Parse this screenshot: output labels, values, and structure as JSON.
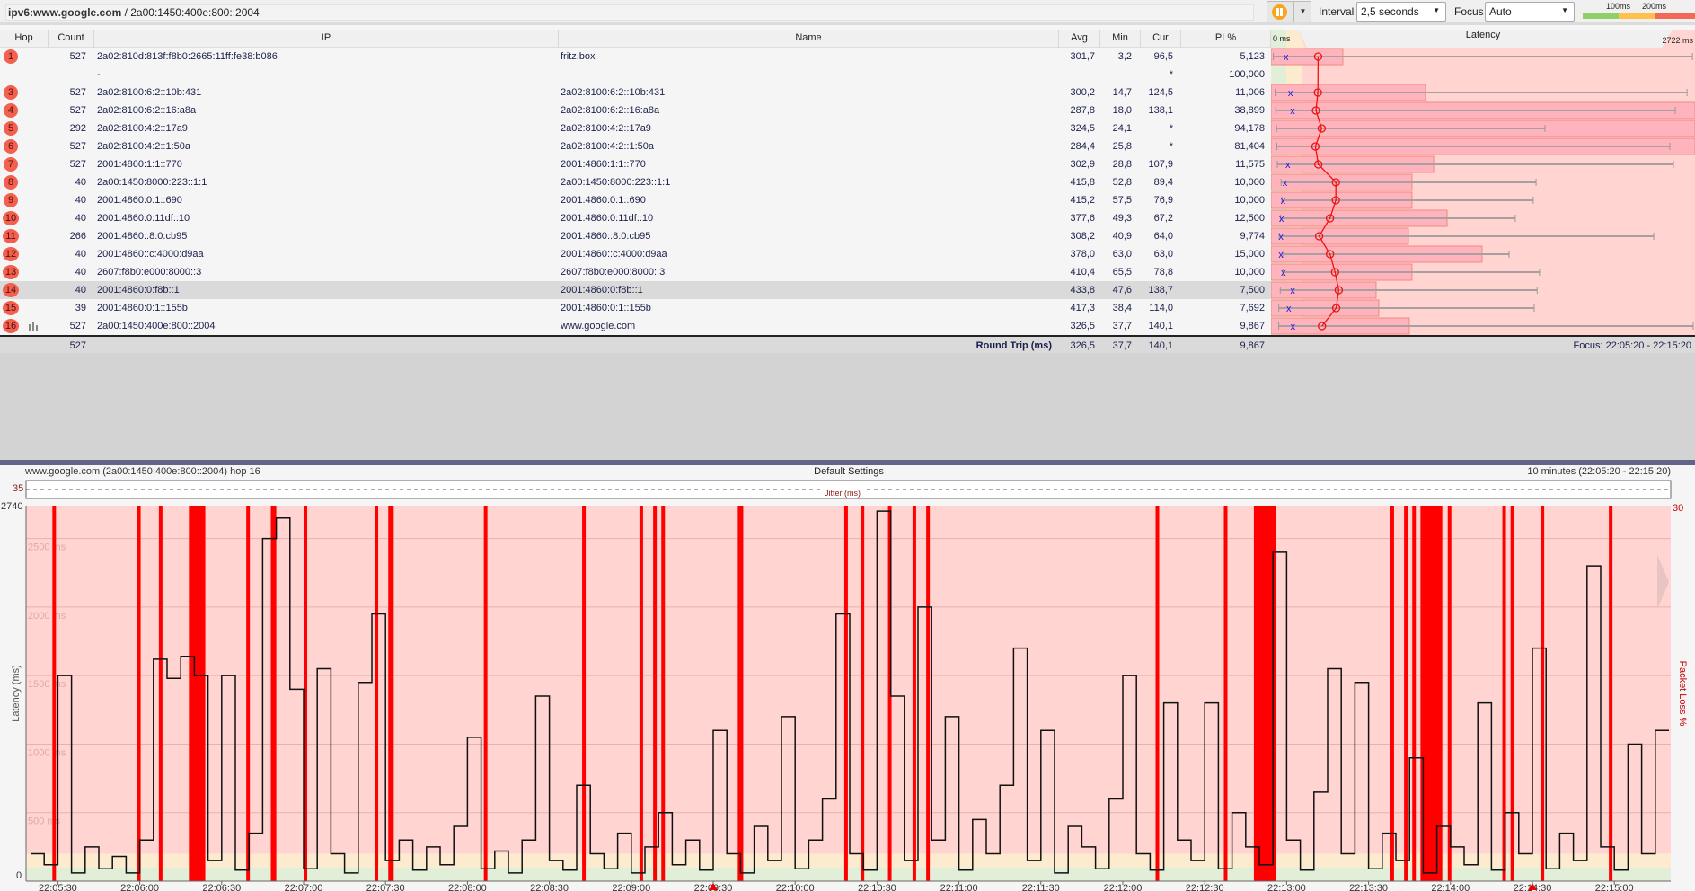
{
  "window": {
    "title_host": "ipv6:www.google.com",
    "title_ip": "/ 2a00:1450:400e:800::2004"
  },
  "toolbar": {
    "pause_icon": "pause-icon",
    "interval_label": "Interval",
    "interval_value": "2,5 seconds",
    "focus_label": "Focus",
    "focus_value": "Auto",
    "legend": {
      "t100": "100ms",
      "t200": "200ms",
      "colors": [
        "#8ed06a",
        "#ffc04c",
        "#f26a55"
      ]
    }
  },
  "table": {
    "headers": {
      "hop": "Hop",
      "count": "Count",
      "ip": "IP",
      "name": "Name",
      "avg": "Avg",
      "min": "Min",
      "cur": "Cur",
      "pl": "PL%",
      "latency": "Latency",
      "lat_min": "0 ms",
      "lat_max": "2722 ms"
    },
    "latency_scale_max_ms": 2722,
    "rows": [
      {
        "hop": "1",
        "count": "527",
        "ip": "2a02:810d:813f:f8b0:2665:11ff:fe38:b086",
        "name": "fritz.box",
        "avg": "301,7",
        "min": "3,2",
        "cur": "96,5",
        "pl": "5,123",
        "bar_ms": 460,
        "max_ms": 2700
      },
      {
        "hop": "",
        "count": "",
        "ip": "-",
        "name": "",
        "avg": "",
        "min": "",
        "cur": "*",
        "pl": "100,000"
      },
      {
        "hop": "3",
        "count": "527",
        "ip": "2a02:8100:6:2::10b:431",
        "name": "2a02:8100:6:2::10b:431",
        "avg": "300,2",
        "min": "14,7",
        "cur": "124,5",
        "pl": "11,006",
        "bar_ms": 990,
        "max_ms": 2665
      },
      {
        "hop": "4",
        "count": "527",
        "ip": "2a02:8100:6:2::16:a8a",
        "name": "2a02:8100:6:2::16:a8a",
        "avg": "287,8",
        "min": "18,0",
        "cur": "138,1",
        "pl": "38,899",
        "bar_ms": 2722,
        "max_ms": 2590
      },
      {
        "hop": "5",
        "count": "292",
        "ip": "2a02:8100:4:2::17a9",
        "name": "2a02:8100:4:2::17a9",
        "avg": "324,5",
        "min": "24,1",
        "cur": "*",
        "pl": "94,178",
        "bar_ms": 2722,
        "max_ms": 1755
      },
      {
        "hop": "6",
        "count": "527",
        "ip": "2a02:8100:4:2::1:50a",
        "name": "2a02:8100:4:2::1:50a",
        "avg": "284,4",
        "min": "25,8",
        "cur": "*",
        "pl": "81,404",
        "bar_ms": 2722,
        "max_ms": 2555
      },
      {
        "hop": "7",
        "count": "527",
        "ip": "2001:4860:1:1::770",
        "name": "2001:4860:1:1::770",
        "avg": "302,9",
        "min": "28,8",
        "cur": "107,9",
        "pl": "11,575",
        "bar_ms": 1042,
        "max_ms": 2578
      },
      {
        "hop": "8",
        "count": "40",
        "ip": "2a00:1450:8000:223::1:1",
        "name": "2a00:1450:8000:223::1:1",
        "avg": "415,8",
        "min": "52,8",
        "cur": "89,4",
        "pl": "10,000",
        "bar_ms": 903,
        "max_ms": 1698
      },
      {
        "hop": "9",
        "count": "40",
        "ip": "2001:4860:0:1::690",
        "name": "2001:4860:0:1::690",
        "avg": "415,2",
        "min": "57,5",
        "cur": "76,9",
        "pl": "10,000",
        "bar_ms": 903,
        "max_ms": 1680
      },
      {
        "hop": "10",
        "count": "40",
        "ip": "2001:4860:0:11df::10",
        "name": "2001:4860:0:11df::10",
        "avg": "377,6",
        "min": "49,3",
        "cur": "67,2",
        "pl": "12,500",
        "bar_ms": 1128,
        "max_ms": 1565
      },
      {
        "hop": "11",
        "count": "266",
        "ip": "2001:4860::8:0:cb95",
        "name": "2001:4860::8:0:cb95",
        "avg": "308,2",
        "min": "40,9",
        "cur": "64,0",
        "pl": "9,774",
        "bar_ms": 880,
        "max_ms": 2452
      },
      {
        "hop": "12",
        "count": "40",
        "ip": "2001:4860::c:4000:d9aa",
        "name": "2001:4860::c:4000:d9aa",
        "avg": "378,0",
        "min": "63,0",
        "cur": "63,0",
        "pl": "15,000",
        "bar_ms": 1352,
        "max_ms": 1525
      },
      {
        "hop": "13",
        "count": "40",
        "ip": "2607:f8b0:e000:8000::3",
        "name": "2607:f8b0:e000:8000::3",
        "avg": "410,4",
        "min": "65,5",
        "cur": "78,8",
        "pl": "10,000",
        "bar_ms": 903,
        "max_ms": 1720
      },
      {
        "hop": "14",
        "count": "40",
        "ip": "2001:4860:0:f8b::1",
        "name": "2001:4860:0:f8b::1",
        "avg": "433,8",
        "min": "47,6",
        "cur": "138,7",
        "pl": "7,500",
        "bar_ms": 673,
        "max_ms": 1705,
        "selected": true
      },
      {
        "hop": "15",
        "count": "39",
        "ip": "2001:4860:0:1::155b",
        "name": "2001:4860:0:1::155b",
        "avg": "417,3",
        "min": "38,4",
        "cur": "114,0",
        "pl": "7,692",
        "bar_ms": 690,
        "max_ms": 1686
      },
      {
        "hop": "16",
        "count": "527",
        "ip": "2a00:1450:400e:800::2004",
        "name": "www.google.com",
        "avg": "326,5",
        "min": "37,7",
        "cur": "140,1",
        "pl": "9,867",
        "bar_ms": 886,
        "max_ms": 2722,
        "icon": "bar-chart-icon"
      }
    ],
    "summary": {
      "count": "527",
      "label": "Round Trip (ms)",
      "avg": "326,5",
      "min": "37,7",
      "cur": "140,1",
      "pl": "9,867",
      "focus": "Focus: 22:05:20 - 22:15:20"
    }
  },
  "chart_data": {
    "type": "line",
    "header_left": "www.google.com (2a00:1450:400e:800::2004) hop 16",
    "header_center": "Default Settings",
    "header_right": "10 minutes (22:05:20 - 22:15:20)",
    "jitter": {
      "label": "Jitter (ms)",
      "value_label": "35"
    },
    "ylabel": "Latency (ms)",
    "y2label": "Packet Loss %",
    "ylim": [
      0,
      2740
    ],
    "y_top_label": "2740",
    "y_bottom_label": "0",
    "y2_top_label": "30",
    "y_grid": [
      {
        "v": 500,
        "label": "500 ms"
      },
      {
        "v": 1000,
        "label": "1000 ms"
      },
      {
        "v": 1500,
        "label": "1500 ms"
      },
      {
        "v": 2000,
        "label": "2000 ms"
      },
      {
        "v": 2500,
        "label": "2500 ms"
      }
    ],
    "zones": [
      {
        "to": 100,
        "color": "#e1efd9"
      },
      {
        "to": 200,
        "color": "#fdebcf"
      },
      {
        "to": 2740,
        "color": "#ffd4d1"
      }
    ],
    "x_start": "22:05:20",
    "x_end": "22:15:20",
    "x_ticks": [
      "22:05:30",
      "22:06:00",
      "22:06:30",
      "22:07:00",
      "22:07:30",
      "22:08:00",
      "22:08:30",
      "22:09:00",
      "22:09:30",
      "22:10:00",
      "22:10:30",
      "22:11:00",
      "22:11:30",
      "22:12:00",
      "22:12:30",
      "22:13:00",
      "22:13:30",
      "22:14:00",
      "22:14:30",
      "22:15:00"
    ],
    "sample_step_s": 5,
    "latency_ms": [
      200,
      120,
      1500,
      60,
      250,
      90,
      180,
      60,
      300,
      1620,
      1480,
      1640,
      1500,
      150,
      1500,
      80,
      350,
      2500,
      2650,
      1400,
      90,
      1550,
      200,
      60,
      1450,
      1950,
      150,
      300,
      80,
      250,
      120,
      400,
      1050,
      90,
      220,
      60,
      300,
      1350,
      150,
      80,
      700,
      200,
      90,
      350,
      60,
      250,
      500,
      120,
      300,
      80,
      1100,
      200,
      60,
      400,
      150,
      1200,
      90,
      300,
      600,
      1950,
      200,
      80,
      2700,
      1350,
      150,
      2000,
      300,
      1200,
      80,
      450,
      200,
      700,
      1700,
      150,
      1100,
      60,
      400,
      250,
      90,
      600,
      1500,
      200,
      80,
      1300,
      300,
      150,
      1300,
      90,
      500,
      250,
      120,
      2400,
      300,
      80,
      650,
      1550,
      200,
      1450,
      90,
      350,
      150,
      900,
      60,
      400,
      250,
      120,
      1300,
      80,
      500,
      200,
      1700,
      90,
      350,
      150,
      2300,
      250,
      80,
      1000,
      200,
      1100
    ],
    "loss_periods": [
      [
        "22:05:28",
        "22:05:29"
      ],
      [
        "22:05:59",
        "22:06:00"
      ],
      [
        "22:06:07",
        "22:06:08"
      ],
      [
        "22:06:18",
        "22:06:24"
      ],
      [
        "22:06:39",
        "22:06:40"
      ],
      [
        "22:06:48",
        "22:06:50"
      ],
      [
        "22:07:00",
        "22:07:01"
      ],
      [
        "22:07:26",
        "22:07:27"
      ],
      [
        "22:07:31",
        "22:07:33"
      ],
      [
        "22:08:06",
        "22:08:07"
      ],
      [
        "22:08:42",
        "22:08:43"
      ],
      [
        "22:09:03",
        "22:09:04"
      ],
      [
        "22:09:08",
        "22:09:09"
      ],
      [
        "22:09:11",
        "22:09:12"
      ],
      [
        "22:09:39",
        "22:09:41"
      ],
      [
        "22:10:18",
        "22:10:19"
      ],
      [
        "22:10:24",
        "22:10:25"
      ],
      [
        "22:10:34",
        "22:10:35"
      ],
      [
        "22:10:43",
        "22:10:44"
      ],
      [
        "22:10:48",
        "22:10:49"
      ],
      [
        "22:12:12",
        "22:12:13"
      ],
      [
        "22:12:37",
        "22:12:38"
      ],
      [
        "22:12:48",
        "22:12:56"
      ],
      [
        "22:13:38",
        "22:13:39"
      ],
      [
        "22:13:43",
        "22:13:44"
      ],
      [
        "22:13:46",
        "22:13:47"
      ],
      [
        "22:13:49",
        "22:13:57"
      ],
      [
        "22:13:59",
        "22:14:00"
      ],
      [
        "22:14:19",
        "22:14:20"
      ],
      [
        "22:14:22",
        "22:14:23"
      ],
      [
        "22:14:33",
        "22:14:34"
      ],
      [
        "22:14:58",
        "22:14:59"
      ]
    ],
    "markers": [
      "22:09:30",
      "22:14:30"
    ],
    "colors": {
      "line": "#111111",
      "loss": "#ff0000"
    }
  }
}
